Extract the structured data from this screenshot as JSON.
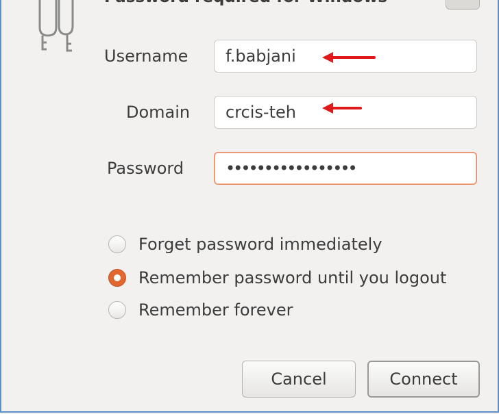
{
  "dialog": {
    "title_partial": "Password required for Windows",
    "close_label": ""
  },
  "form": {
    "username": {
      "label": "Username",
      "value": "f.babjani"
    },
    "domain": {
      "label": "Domain",
      "value": "crcis-teh"
    },
    "password": {
      "label": "Password",
      "value": "•••••••••••••••••"
    }
  },
  "options": [
    {
      "label": "Forget password immediately",
      "checked": false
    },
    {
      "label": "Remember password until you logout",
      "checked": true
    },
    {
      "label": "Remember forever",
      "checked": false
    }
  ],
  "buttons": {
    "cancel": "Cancel",
    "connect": "Connect"
  },
  "colors": {
    "accent": "#e1662f",
    "annotation_arrow": "#e01a1a",
    "frame_border": "#5b8fc7"
  },
  "icons": {
    "dialog_icon": "keys-icon",
    "annotation": "arrow-left-icon"
  }
}
